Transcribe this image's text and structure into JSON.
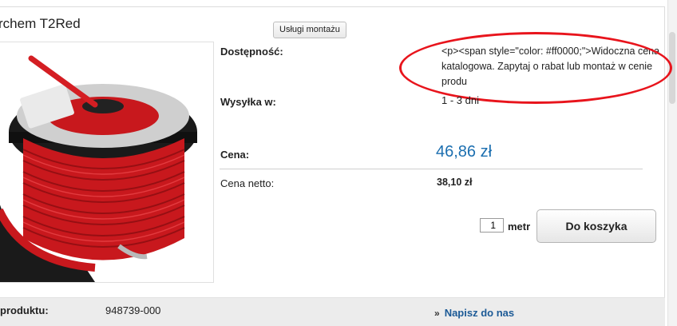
{
  "product": {
    "title": "rchem T2Red",
    "services_button": "Usługi montażu"
  },
  "details": {
    "availability_label": "Dostępność:",
    "availability_value": "<p><span style=\"color: #ff0000;\">Widoczna cena katalogowa.  Zapytaj o rabat lub montaż w cenie produ",
    "shipping_label": "Wysyłka w:",
    "shipping_value": "1 - 3 dni",
    "price_label": "Cena:",
    "price_value": "46,86 zł",
    "net_label": "Cena netto:",
    "net_value": "38,10 zł"
  },
  "cart": {
    "quantity": "1",
    "unit": "metr",
    "button": "Do koszyka"
  },
  "footer": {
    "product_id_label": "produktu:",
    "product_id_value": "948739-000",
    "contact_arrow": "»",
    "contact_link": "Napisz do nas"
  },
  "colors": {
    "accent": "#1c6fb0",
    "annotation": "#e8141c",
    "cable": "#d41e23"
  }
}
